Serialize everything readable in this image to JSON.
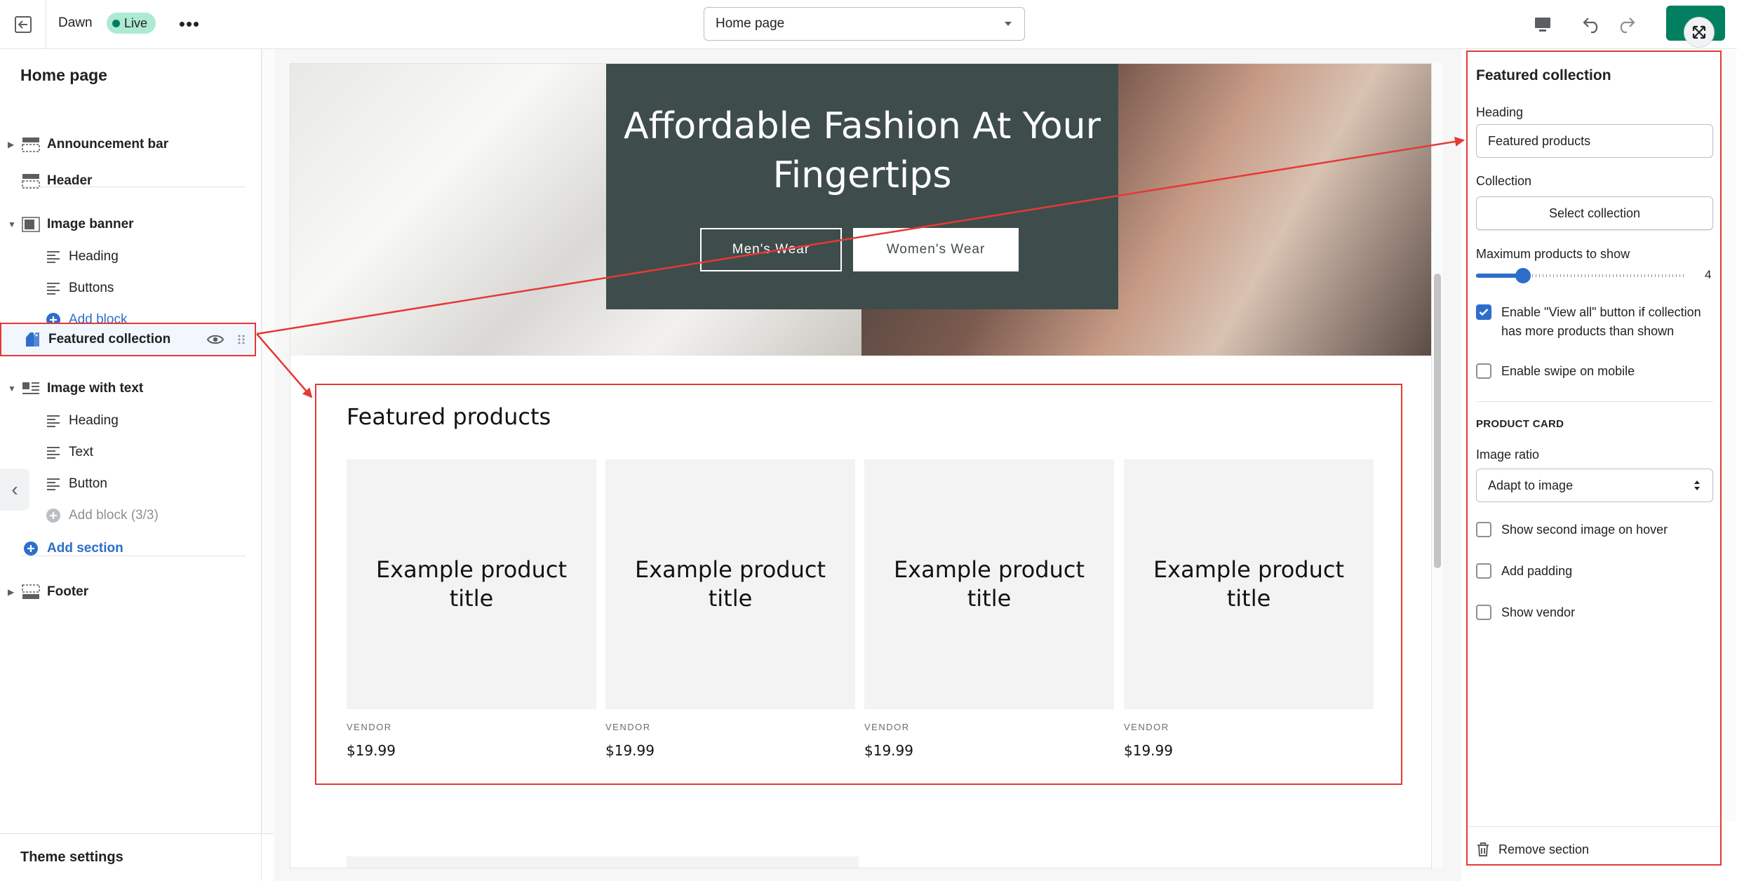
{
  "topbar": {
    "theme_name": "Dawn",
    "live_badge": "Live",
    "more_label": "•••",
    "page_select_value": "Home page"
  },
  "sidebar": {
    "title": "Home page",
    "items": [
      {
        "label": "Announcement bar"
      },
      {
        "label": "Header"
      },
      {
        "label": "Image banner"
      },
      {
        "label": "Heading"
      },
      {
        "label": "Buttons"
      },
      {
        "label": "Add block"
      },
      {
        "label": "Featured collection"
      },
      {
        "label": "Image with text"
      },
      {
        "label": "Heading"
      },
      {
        "label": "Text"
      },
      {
        "label": "Button"
      },
      {
        "label": "Add block (3/3)"
      },
      {
        "label": "Add section"
      },
      {
        "label": "Footer"
      }
    ],
    "theme_settings": "Theme settings"
  },
  "banner": {
    "heading": "Affordable Fashion At Your Fingertips",
    "buttons": [
      "Men's Wear",
      "Women's Wear"
    ]
  },
  "featured": {
    "title": "Featured products",
    "products": [
      {
        "title": "Example product title",
        "vendor": "VENDOR",
        "price": "$19.99"
      },
      {
        "title": "Example product title",
        "vendor": "VENDOR",
        "price": "$19.99"
      },
      {
        "title": "Example product title",
        "vendor": "VENDOR",
        "price": "$19.99"
      },
      {
        "title": "Example product title",
        "vendor": "VENDOR",
        "price": "$19.99"
      }
    ]
  },
  "panel": {
    "title": "Featured collection",
    "heading_label": "Heading",
    "heading_value": "Featured products",
    "collection_label": "Collection",
    "select_collection": "Select collection",
    "max_products_label": "Maximum products to show",
    "max_products_value": "4",
    "view_all_label": "Enable \"View all\" button if collection has more products than shown",
    "swipe_label": "Enable swipe on mobile",
    "product_card_heading": "PRODUCT CARD",
    "image_ratio_label": "Image ratio",
    "image_ratio_value": "Adapt to image",
    "second_image_label": "Show second image on hover",
    "padding_label": "Add padding",
    "vendor_label": "Show vendor",
    "remove_section": "Remove section"
  },
  "colors": {
    "accent": "#2c6ecb",
    "annotation": "#e53935",
    "live_badge": "#aee9d1",
    "save_button": "#008060",
    "banner_card": "#3e4d4b"
  }
}
